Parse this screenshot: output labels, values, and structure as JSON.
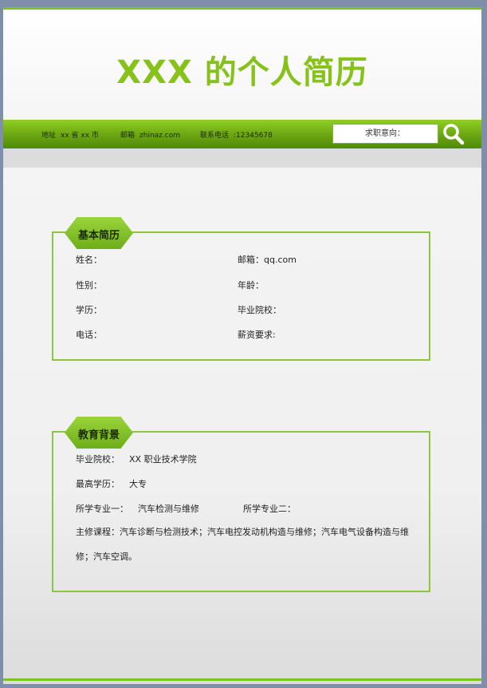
{
  "title": "XXX 的个人简历",
  "nav": {
    "address_label": "地址",
    "address_value": "xx 省 xx 市",
    "email_label": "邮箱",
    "email_value": "zhinaz.com",
    "phone_label": "联系电话",
    "phone_value": ":12345678",
    "job_intent_label": "求职意向："
  },
  "basic": {
    "heading": "基本简历",
    "name_label": "姓名：",
    "email_label": "邮箱：qq.com",
    "gender_label": "性别：",
    "age_label": "年龄：",
    "education_label": "学历：",
    "school_label": "毕业院校：",
    "phone_label": "电话：",
    "salary_label": "薪资要求:"
  },
  "edu": {
    "heading": "教育背景",
    "school_label": "毕业院校：",
    "school_value": "XX 职业技术学院",
    "degree_label": "最高学历：",
    "degree_value": "大专",
    "major1_label": "所学专业一：",
    "major1_value": "汽车检测与维修",
    "major2_label": "所学专业二：",
    "courses": "主修课程：汽车诊断与检测技术；汽车电控发动机构造与维修；汽车电气设备构造与维修；汽车空调。"
  },
  "colors": {
    "accent": "#86c21a",
    "nav_green": "#6aa512",
    "border_green": "#8cc63f"
  },
  "icons": {
    "search": "search-icon"
  }
}
